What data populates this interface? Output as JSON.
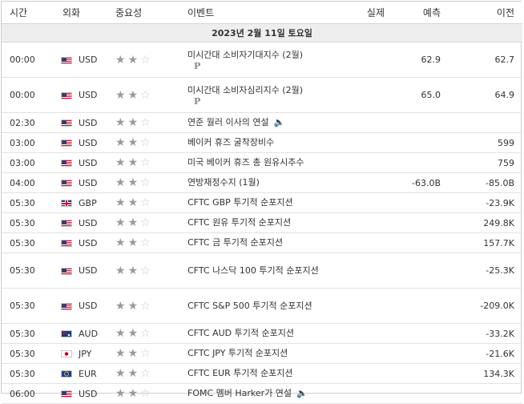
{
  "headers": {
    "time": "시간",
    "currency": "외화",
    "importance": "중요성",
    "event": "이벤트",
    "actual": "실제",
    "forecast": "예측",
    "previous": "이전"
  },
  "date_label": "2023년 2월 11일 토요일",
  "rows": [
    {
      "time": "00:00",
      "flag": "us",
      "currency": "USD",
      "stars": 2,
      "event": "미시간대 소비자기대지수 (2월)",
      "badge": "P",
      "speaker": false,
      "actual": "",
      "forecast": "62.9",
      "previous": "62.7"
    },
    {
      "time": "00:00",
      "flag": "us",
      "currency": "USD",
      "stars": 2,
      "event": "미시간대 소비자심리지수 (2월)",
      "badge": "P",
      "speaker": false,
      "actual": "",
      "forecast": "65.0",
      "previous": "64.9"
    },
    {
      "time": "02:30",
      "flag": "us",
      "currency": "USD",
      "stars": 2,
      "event": "연준 월러 이사의 연설",
      "badge": "",
      "speaker": true,
      "actual": "",
      "forecast": "",
      "previous": ""
    },
    {
      "time": "03:00",
      "flag": "us",
      "currency": "USD",
      "stars": 2,
      "event": "베이커 휴즈 굴착장비수",
      "badge": "",
      "speaker": false,
      "actual": "",
      "forecast": "",
      "previous": "599"
    },
    {
      "time": "03:00",
      "flag": "us",
      "currency": "USD",
      "stars": 2,
      "event": "미국 베이커 휴즈 총 원유시추수",
      "badge": "",
      "speaker": false,
      "actual": "",
      "forecast": "",
      "previous": "759"
    },
    {
      "time": "04:00",
      "flag": "us",
      "currency": "USD",
      "stars": 2,
      "event": "연방재정수지 (1월)",
      "badge": "",
      "speaker": false,
      "actual": "",
      "forecast": "-63.0B",
      "previous": "-85.0B"
    },
    {
      "time": "05:30",
      "flag": "gb",
      "currency": "GBP",
      "stars": 2,
      "event": "CFTC GBP 투기적 순포지션",
      "badge": "",
      "speaker": false,
      "actual": "",
      "forecast": "",
      "previous": "-23.9K"
    },
    {
      "time": "05:30",
      "flag": "us",
      "currency": "USD",
      "stars": 2,
      "event": "CFTC 원유 투기적 순포지션",
      "badge": "",
      "speaker": false,
      "actual": "",
      "forecast": "",
      "previous": "249.8K"
    },
    {
      "time": "05:30",
      "flag": "us",
      "currency": "USD",
      "stars": 2,
      "event": "CFTC 금 투기적 순포지션",
      "badge": "",
      "speaker": false,
      "actual": "",
      "forecast": "",
      "previous": "157.7K"
    },
    {
      "time": "05:30",
      "flag": "us",
      "currency": "USD",
      "stars": 2,
      "event": "CFTC 나스닥 100 투기적 순포지션",
      "badge": "",
      "speaker": false,
      "actual": "",
      "forecast": "",
      "previous": "-25.3K"
    },
    {
      "time": "05:30",
      "flag": "us",
      "currency": "USD",
      "stars": 2,
      "event": "CFTC S&P 500 투기적 순포지션",
      "badge": "",
      "speaker": false,
      "actual": "",
      "forecast": "",
      "previous": "-209.0K"
    },
    {
      "time": "05:30",
      "flag": "au",
      "currency": "AUD",
      "stars": 2,
      "event": "CFTC AUD 투기적 순포지션",
      "badge": "",
      "speaker": false,
      "actual": "",
      "forecast": "",
      "previous": "-33.2K"
    },
    {
      "time": "05:30",
      "flag": "jp",
      "currency": "JPY",
      "stars": 2,
      "event": "CFTC JPY 투기적 순포지션",
      "badge": "",
      "speaker": false,
      "actual": "",
      "forecast": "",
      "previous": "-21.6K"
    },
    {
      "time": "05:30",
      "flag": "eu",
      "currency": "EUR",
      "stars": 2,
      "event": "CFTC EUR 투기적 순포지션",
      "badge": "",
      "speaker": false,
      "actual": "",
      "forecast": "",
      "previous": "134.3K"
    },
    {
      "time": "06:00",
      "flag": "us",
      "currency": "USD",
      "stars": 2,
      "event": "FOMC 멤버 Harker가 연설",
      "badge": "",
      "speaker": true,
      "actual": "",
      "forecast": "",
      "previous": ""
    }
  ],
  "icons": {
    "star": "star-icon",
    "speaker": "speaker-icon"
  },
  "colors": {
    "header_bg": "#ffffff",
    "date_bar_bg": "#eeeeee",
    "star_on": "#9a9a9a",
    "star_off": "#c8c8c8"
  }
}
